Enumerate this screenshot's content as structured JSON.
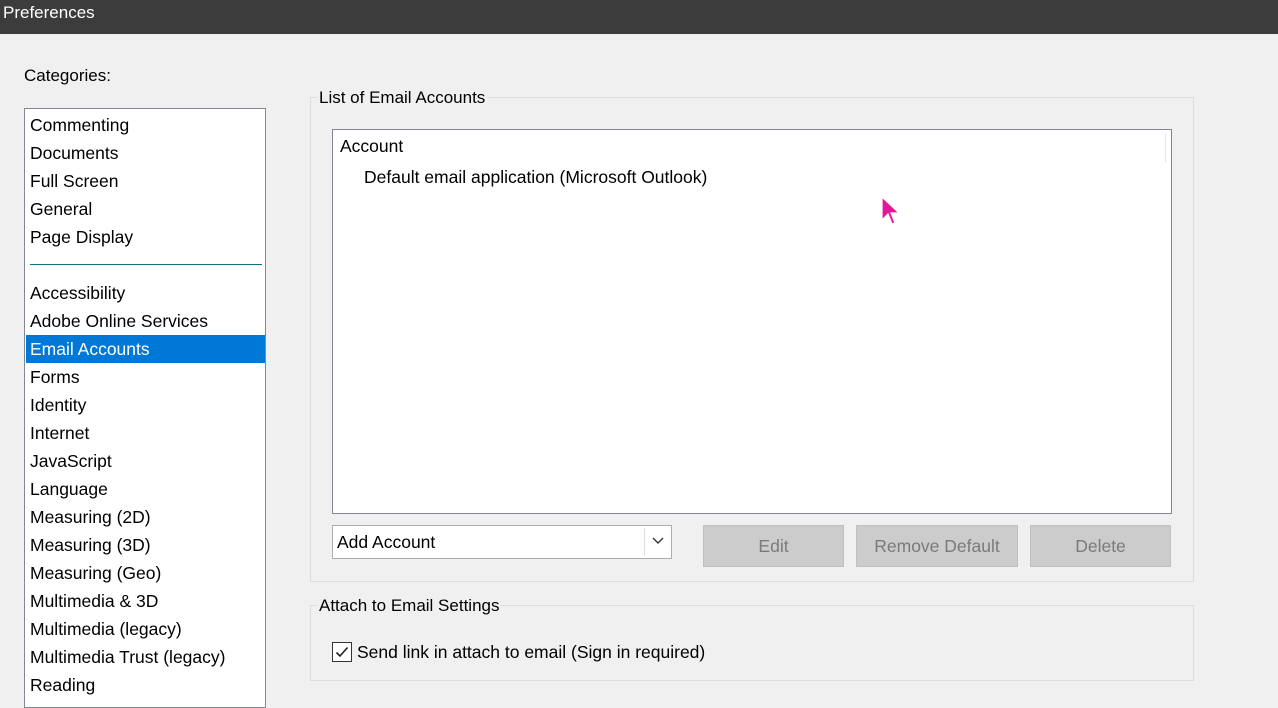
{
  "window": {
    "title": "Preferences"
  },
  "categories": {
    "label": "Categories:",
    "group1": [
      "Commenting",
      "Documents",
      "Full Screen",
      "General",
      "Page Display"
    ],
    "group2": [
      "Accessibility",
      "Adobe Online Services",
      "Email Accounts",
      "Forms",
      "Identity",
      "Internet",
      "JavaScript",
      "Language",
      "Measuring (2D)",
      "Measuring (3D)",
      "Measuring (Geo)",
      "Multimedia & 3D",
      "Multimedia (legacy)",
      "Multimedia Trust (legacy)",
      "Reading"
    ],
    "selected": "Email Accounts"
  },
  "email_accounts": {
    "group_title": "List of Email Accounts",
    "column_header": "Account",
    "rows": [
      "Default email application (Microsoft Outlook)"
    ],
    "add_account": {
      "selected_value": "Add Account"
    },
    "buttons": {
      "edit": "Edit",
      "remove_default": "Remove Default",
      "delete": "Delete"
    }
  },
  "attach_settings": {
    "group_title": "Attach to Email Settings",
    "send_link_label": "Send link in attach to email (Sign in required)",
    "send_link_checked": true
  },
  "colors": {
    "selection": "#0078d7",
    "titlebar": "#3c3c3c",
    "cursor": "#e3179b"
  }
}
